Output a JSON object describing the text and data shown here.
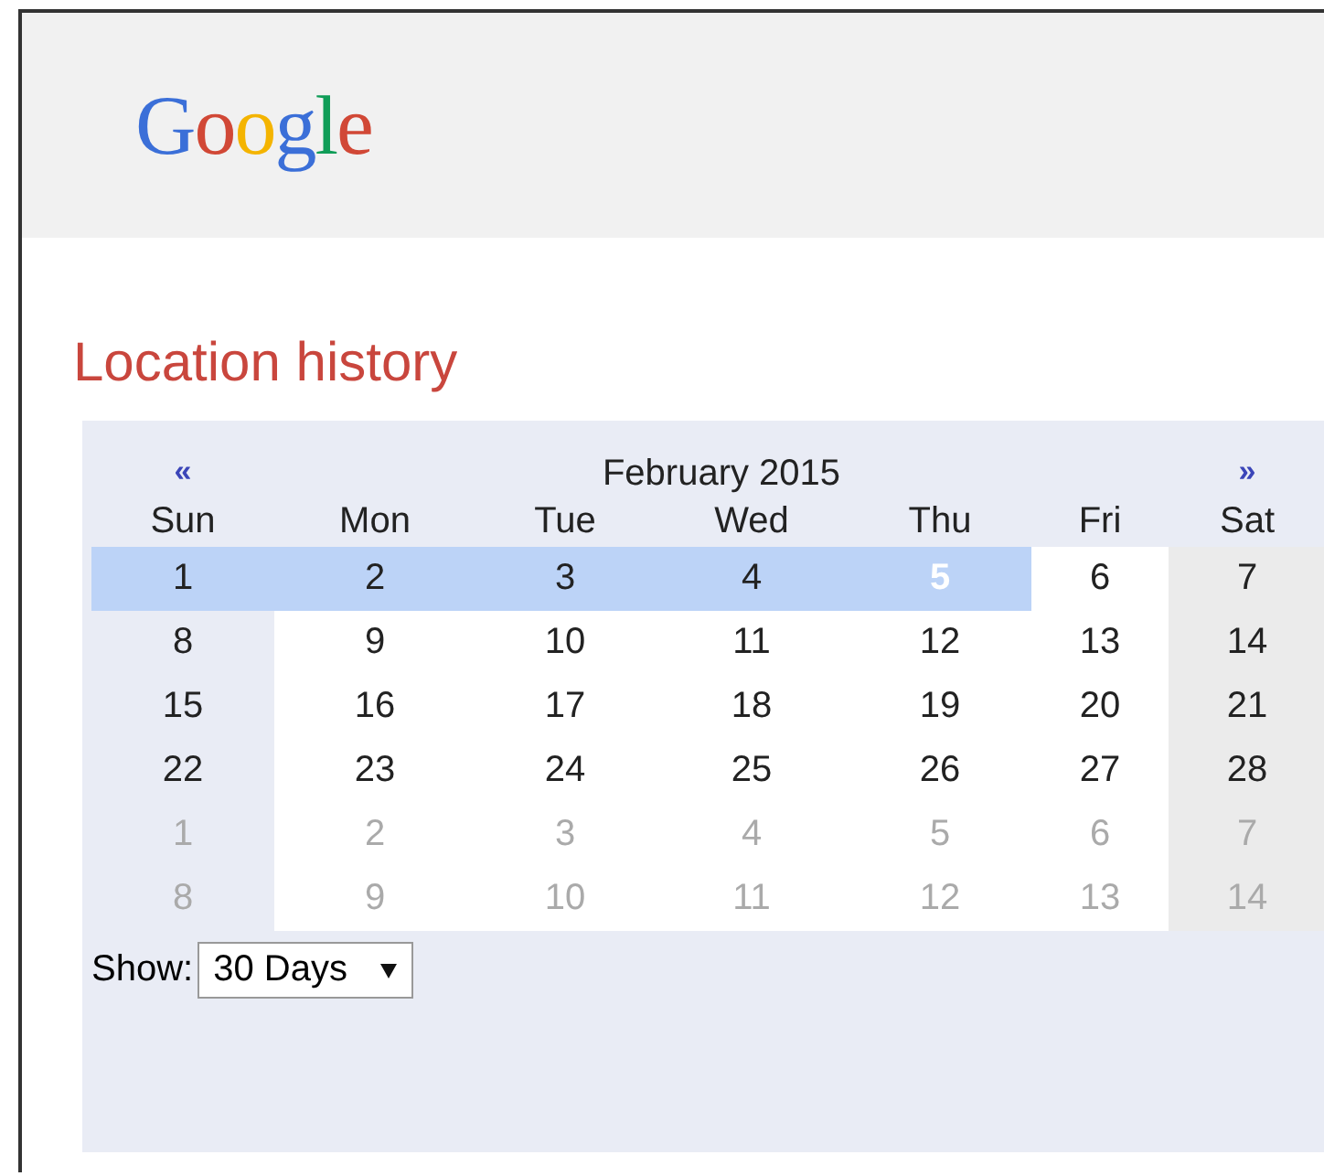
{
  "logo": "Google",
  "title": "Location history",
  "calendar": {
    "prev": "«",
    "month": "February 2015",
    "next": "»",
    "weekdays": [
      "Sun",
      "Mon",
      "Tue",
      "Wed",
      "Thu",
      "Fri",
      "Sat"
    ],
    "weeks": [
      [
        {
          "day": "1",
          "selected": true,
          "other_month": false,
          "today": false
        },
        {
          "day": "2",
          "selected": true,
          "other_month": false,
          "today": false
        },
        {
          "day": "3",
          "selected": true,
          "other_month": false,
          "today": false
        },
        {
          "day": "4",
          "selected": true,
          "other_month": false,
          "today": false
        },
        {
          "day": "5",
          "selected": true,
          "other_month": false,
          "today": true
        },
        {
          "day": "6",
          "selected": false,
          "other_month": false,
          "today": false
        },
        {
          "day": "7",
          "selected": false,
          "other_month": false,
          "today": false
        }
      ],
      [
        {
          "day": "8",
          "selected": false,
          "other_month": false,
          "today": false
        },
        {
          "day": "9",
          "selected": false,
          "other_month": false,
          "today": false
        },
        {
          "day": "10",
          "selected": false,
          "other_month": false,
          "today": false
        },
        {
          "day": "11",
          "selected": false,
          "other_month": false,
          "today": false
        },
        {
          "day": "12",
          "selected": false,
          "other_month": false,
          "today": false
        },
        {
          "day": "13",
          "selected": false,
          "other_month": false,
          "today": false
        },
        {
          "day": "14",
          "selected": false,
          "other_month": false,
          "today": false
        }
      ],
      [
        {
          "day": "15",
          "selected": false,
          "other_month": false,
          "today": false
        },
        {
          "day": "16",
          "selected": false,
          "other_month": false,
          "today": false
        },
        {
          "day": "17",
          "selected": false,
          "other_month": false,
          "today": false
        },
        {
          "day": "18",
          "selected": false,
          "other_month": false,
          "today": false
        },
        {
          "day": "19",
          "selected": false,
          "other_month": false,
          "today": false
        },
        {
          "day": "20",
          "selected": false,
          "other_month": false,
          "today": false
        },
        {
          "day": "21",
          "selected": false,
          "other_month": false,
          "today": false
        }
      ],
      [
        {
          "day": "22",
          "selected": false,
          "other_month": false,
          "today": false
        },
        {
          "day": "23",
          "selected": false,
          "other_month": false,
          "today": false
        },
        {
          "day": "24",
          "selected": false,
          "other_month": false,
          "today": false
        },
        {
          "day": "25",
          "selected": false,
          "other_month": false,
          "today": false
        },
        {
          "day": "26",
          "selected": false,
          "other_month": false,
          "today": false
        },
        {
          "day": "27",
          "selected": false,
          "other_month": false,
          "today": false
        },
        {
          "day": "28",
          "selected": false,
          "other_month": false,
          "today": false
        }
      ],
      [
        {
          "day": "1",
          "selected": false,
          "other_month": true,
          "today": false
        },
        {
          "day": "2",
          "selected": false,
          "other_month": true,
          "today": false
        },
        {
          "day": "3",
          "selected": false,
          "other_month": true,
          "today": false
        },
        {
          "day": "4",
          "selected": false,
          "other_month": true,
          "today": false
        },
        {
          "day": "5",
          "selected": false,
          "other_month": true,
          "today": false
        },
        {
          "day": "6",
          "selected": false,
          "other_month": true,
          "today": false
        },
        {
          "day": "7",
          "selected": false,
          "other_month": true,
          "today": false
        }
      ],
      [
        {
          "day": "8",
          "selected": false,
          "other_month": true,
          "today": false
        },
        {
          "day": "9",
          "selected": false,
          "other_month": true,
          "today": false
        },
        {
          "day": "10",
          "selected": false,
          "other_month": true,
          "today": false
        },
        {
          "day": "11",
          "selected": false,
          "other_month": true,
          "today": false
        },
        {
          "day": "12",
          "selected": false,
          "other_month": true,
          "today": false
        },
        {
          "day": "13",
          "selected": false,
          "other_month": true,
          "today": false
        },
        {
          "day": "14",
          "selected": false,
          "other_month": true,
          "today": false
        }
      ]
    ]
  },
  "show": {
    "label": "Show:",
    "value": "30 Days"
  }
}
